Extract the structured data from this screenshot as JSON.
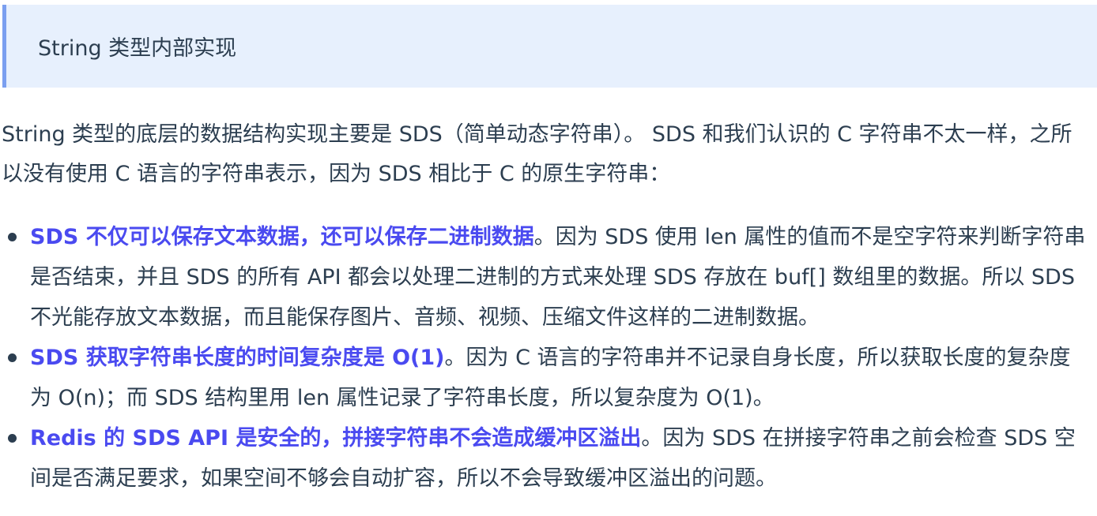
{
  "callout": {
    "text": "String 类型内部实现"
  },
  "intro": {
    "text": "String 类型的底层的数据结构实现主要是 SDS（简单动态字符串）。 SDS 和我们认识的 C 字符串不太一样，之所以没有使用 C 语言的字符串表示，因为 SDS 相比于 C 的原生字符串："
  },
  "bullets": [
    {
      "highlight": "SDS 不仅可以保存文本数据，还可以保存二进制数据",
      "text": "。因为 SDS 使用 len 属性的值而不是空字符来判断字符串是否结束，并且 SDS 的所有 API 都会以处理二进制的方式来处理 SDS 存放在 buf[] 数组里的数据。所以 SDS 不光能存放文本数据，而且能保存图片、音频、视频、压缩文件这样的二进制数据。"
    },
    {
      "highlight": "SDS 获取字符串长度的时间复杂度是 O(1)",
      "text": "。因为 C 语言的字符串并不记录自身长度，所以获取长度的复杂度为 O(n)；而 SDS 结构里用 len 属性记录了字符串长度，所以复杂度为 O(1)。"
    },
    {
      "highlight": "Redis 的 SDS API 是安全的，拼接字符串不会造成缓冲区溢出",
      "text": "。因为 SDS 在拼接字符串之前会检查 SDS 空间是否满足要求，如果空间不够会自动扩容，所以不会导致缓冲区溢出的问题。"
    }
  ],
  "colors": {
    "highlight": "#4a4af0",
    "text": "#2c3e50",
    "callout_bg": "#e7f0fd",
    "callout_border": "#7b9ff0"
  }
}
